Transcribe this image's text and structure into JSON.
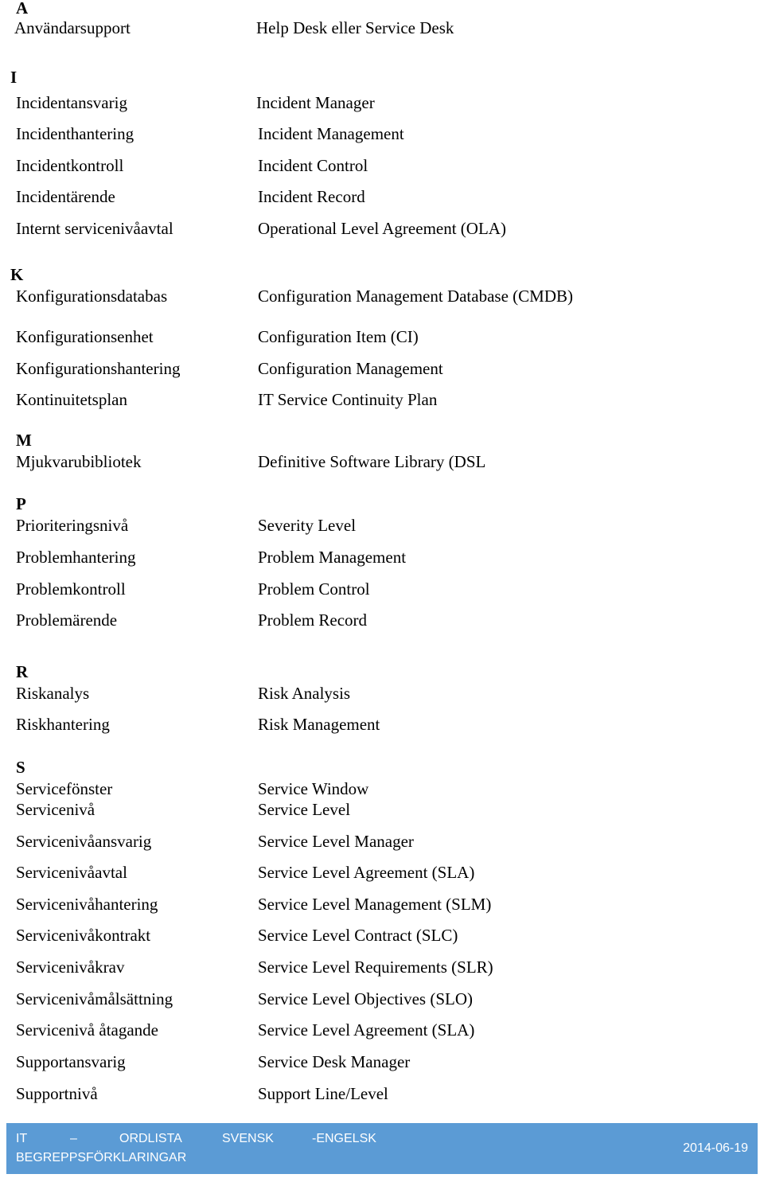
{
  "sections": [
    {
      "letter": "A",
      "entries": [
        {
          "sv": "Användarsupport",
          "en": "Help Desk eller Service Desk"
        }
      ]
    },
    {
      "letter": "I",
      "entries": [
        {
          "sv": "Incidentansvarig",
          "en": "Incident Manager"
        },
        {
          "sv": "Incidenthantering",
          "en": "Incident Management"
        },
        {
          "sv": "Incidentkontroll",
          "en": "Incident Control"
        },
        {
          "sv": "Incidentärende",
          "en": "Incident Record"
        },
        {
          "sv": "Internt servicenivåavtal",
          "en": "Operational Level Agreement (OLA)"
        }
      ]
    },
    {
      "letter": "K",
      "entries": [
        {
          "sv": "Konfigurationsdatabas",
          "en": "Configuration Management Database (CMDB)"
        },
        {
          "sv": "Konfigurationsenhet",
          "en": "Configuration Item (CI)"
        },
        {
          "sv": "Konfigurationshantering",
          "en": "Configuration Management"
        },
        {
          "sv": "Kontinuitetsplan",
          "en": "IT Service Continuity Plan"
        }
      ]
    },
    {
      "letter": "M",
      "entries": [
        {
          "sv": "Mjukvarubibliotek",
          "en": "Definitive Software Library (DSL"
        }
      ]
    },
    {
      "letter": "P",
      "entries": [
        {
          "sv": "Prioriteringsnivå",
          "en": "Severity Level"
        },
        {
          "sv": "Problemhantering",
          "en": "Problem Management"
        },
        {
          "sv": "Problemkontroll",
          "en": "Problem Control"
        },
        {
          "sv": "Problemärende",
          "en": "Problem Record"
        }
      ]
    },
    {
      "letter": "R",
      "entries": [
        {
          "sv": "Riskanalys",
          "en": "Risk Analysis"
        },
        {
          "sv": "Riskhantering",
          "en": "Risk Management"
        }
      ]
    },
    {
      "letter": "S",
      "entries": [
        {
          "sv": "Servicefönster",
          "en": "Service Window"
        },
        {
          "sv": "Servicenivå",
          "en": "Service Level"
        },
        {
          "sv": "Servicenivåansvarig",
          "en": "Service Level Manager"
        },
        {
          "sv": "Servicenivåavtal",
          "en": "Service Level Agreement (SLA)"
        },
        {
          "sv": "Servicenivåhantering",
          "en": "Service Level Management (SLM)"
        },
        {
          "sv": "Servicenivåkontrakt",
          "en": "Service Level Contract (SLC)"
        },
        {
          "sv": "Servicenivåkrav",
          "en": "Service Level Requirements (SLR)"
        },
        {
          "sv": "Servicenivåmålsättning",
          "en": "Service Level Objectives (SLO)"
        },
        {
          "sv": "Servicenivå åtagande",
          "en": "Service Level Agreement (SLA)"
        },
        {
          "sv": "Supportansvarig",
          "en": "Service Desk Manager"
        },
        {
          "sv": "Supportnivå",
          "en": "Support Line/Level"
        }
      ]
    }
  ],
  "footer": {
    "words": [
      "IT",
      "–",
      "ORDLISTA",
      "SVENSK",
      "-ENGELSK"
    ],
    "line2": "BEGREPPSFÖRKLARINGAR",
    "date": "2014-06-19",
    "background": "#5b9bd5"
  }
}
